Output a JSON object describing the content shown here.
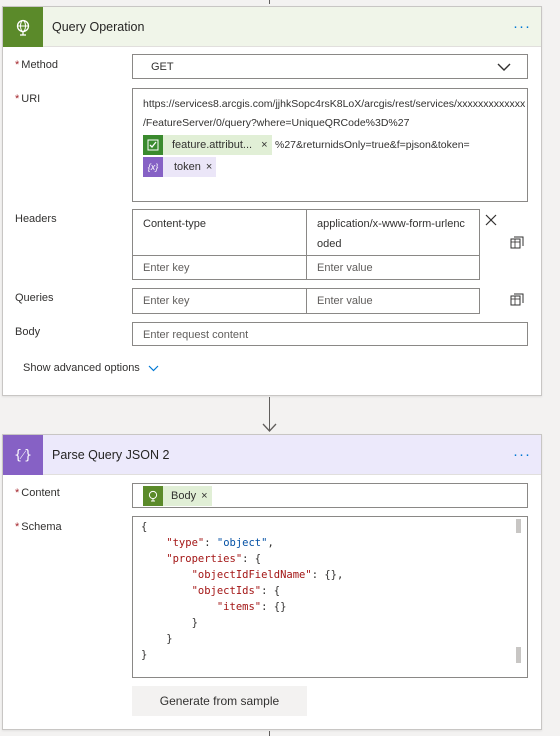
{
  "query_card": {
    "title": "Query Operation",
    "more_label": "···",
    "method": {
      "label": "Method",
      "required_mark": "*",
      "value": "GET"
    },
    "uri": {
      "label": "URI",
      "required_mark": "*",
      "line1": "https://services8.arcgis.com/jjhkSopc4rsK8LoX/arcgis/rest/services/xxxxxxxxxxxxx",
      "line2": "/FeatureServer/0/query?where=UniqueQRCode%3D%27",
      "token1": "feature.attribut...",
      "after_token1": "%27&returnidsOnly=true&f=pjson&token=",
      "token2": "token",
      "remove_glyph": "×"
    },
    "headers": {
      "label": "Headers",
      "rows": [
        {
          "key": "Content-type",
          "value_line1": "application/x-www-form-urlenc",
          "value_line2": "oded"
        }
      ],
      "key_placeholder": "Enter key",
      "value_placeholder": "Enter value"
    },
    "queries": {
      "label": "Queries",
      "key_placeholder": "Enter key",
      "value_placeholder": "Enter value"
    },
    "body": {
      "label": "Body",
      "placeholder": "Enter request content"
    },
    "advanced_label": "Show advanced options"
  },
  "parse_card": {
    "title": "Parse Query JSON 2",
    "more_label": "···",
    "content": {
      "label": "Content",
      "required_mark": "*",
      "token": "Body",
      "remove_glyph": "×"
    },
    "schema": {
      "label": "Schema",
      "required_mark": "*",
      "lines": [
        {
          "k": "",
          "rest": "{"
        },
        {
          "k": "    \"type\"",
          "rest": ": ",
          "s": "\"object\"",
          "tail": ","
        },
        {
          "k": "    \"properties\"",
          "rest": ": {"
        },
        {
          "k": "        \"objectIdFieldName\"",
          "rest": ": {},"
        },
        {
          "k": "        \"objectIds\"",
          "rest": ": {"
        },
        {
          "k": "            \"items\"",
          "rest": ": {}"
        },
        {
          "k": "",
          "rest": "        }"
        },
        {
          "k": "",
          "rest": "    }"
        },
        {
          "k": "",
          "rest": "}"
        }
      ]
    },
    "generate_label": "Generate from sample"
  },
  "colors": {
    "query_header_bg": "#f0f5e9",
    "query_icon_bg": "#5b8a2a",
    "parse_header_bg": "#ece9fb",
    "parse_icon_bg": "#8661c5",
    "accent_blue": "#0078d4"
  }
}
